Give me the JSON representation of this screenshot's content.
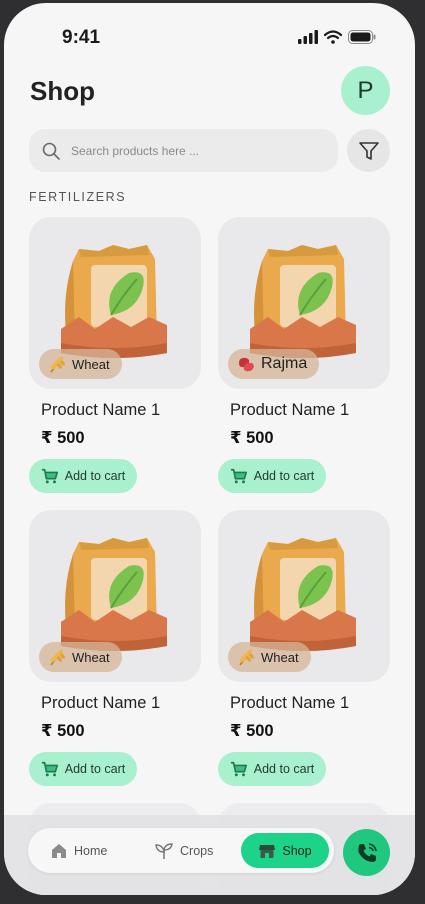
{
  "status": {
    "time": "9:41"
  },
  "header": {
    "title": "Shop",
    "avatar_letter": "P"
  },
  "search": {
    "placeholder": "Search products here ..."
  },
  "section_title": "FERTILIZERS",
  "products": [
    {
      "name": "Product Name 1",
      "price": "₹ 500",
      "tag": "Wheat",
      "tag_icon": "wheat-icon",
      "cart_label": "Add to cart"
    },
    {
      "name": "Product Name 1",
      "price": "₹ 500",
      "tag": "Rajma",
      "tag_icon": "bean-icon",
      "cart_label": "Add to cart"
    },
    {
      "name": "Product Name 1",
      "price": "₹ 500",
      "tag": "Wheat",
      "tag_icon": "wheat-icon",
      "cart_label": "Add to cart"
    },
    {
      "name": "Product Name 1",
      "price": "₹ 500",
      "tag": "Wheat",
      "tag_icon": "wheat-icon",
      "cart_label": "Add to cart"
    }
  ],
  "nav": {
    "home": "Home",
    "crops": "Crops",
    "shop": "Shop",
    "active": "Shop"
  },
  "colors": {
    "accent": "#a9f0cf",
    "active_nav": "#1dd38a",
    "call": "#20c77f"
  }
}
